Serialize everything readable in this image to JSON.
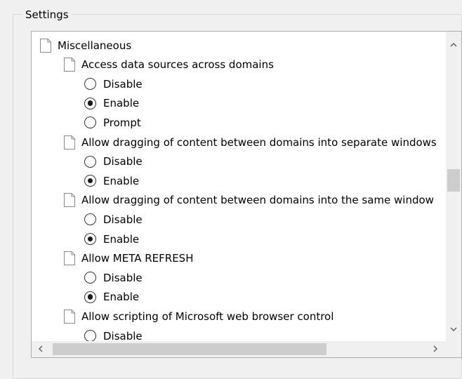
{
  "group": {
    "title": "Settings"
  },
  "settings": {
    "category": "Miscellaneous",
    "items": [
      {
        "label": "Access data sources across domains",
        "options": [
          {
            "label": "Disable",
            "checked": false
          },
          {
            "label": "Enable",
            "checked": true
          },
          {
            "label": "Prompt",
            "checked": false
          }
        ]
      },
      {
        "label": "Allow dragging of content between domains into separate windows",
        "options": [
          {
            "label": "Disable",
            "checked": false
          },
          {
            "label": "Enable",
            "checked": true
          }
        ]
      },
      {
        "label": "Allow dragging of content between domains into the same window",
        "options": [
          {
            "label": "Disable",
            "checked": false
          },
          {
            "label": "Enable",
            "checked": true
          }
        ]
      },
      {
        "label": "Allow META REFRESH",
        "options": [
          {
            "label": "Disable",
            "checked": false
          },
          {
            "label": "Enable",
            "checked": true
          }
        ]
      },
      {
        "label": "Allow scripting of Microsoft web browser control",
        "options": [
          {
            "label": "Disable",
            "checked": false
          }
        ]
      }
    ]
  },
  "scrollbars": {
    "vertical": {
      "up_icon": "chevron-up-icon",
      "down_icon": "chevron-down-icon"
    },
    "horizontal": {
      "left_icon": "chevron-left-icon",
      "right_icon": "chevron-right-icon"
    }
  }
}
